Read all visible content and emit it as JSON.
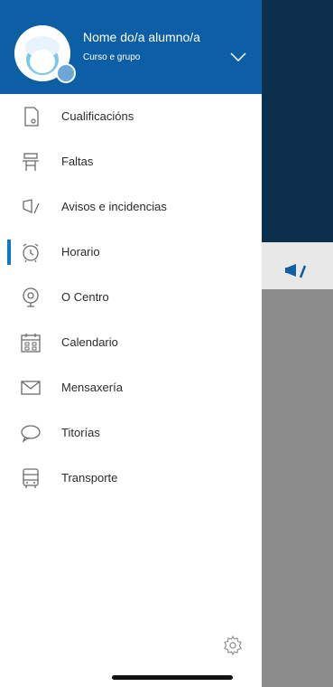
{
  "profile": {
    "name": "Nome do/a alumno/a",
    "group": "Curso e grupo"
  },
  "menu": [
    {
      "label": "Cualificacións",
      "icon": "grades-document-icon",
      "active": false
    },
    {
      "label": "Faltas",
      "icon": "school-desk-icon",
      "active": false
    },
    {
      "label": "Avisos e incidencias",
      "icon": "megaphone-icon",
      "active": false
    },
    {
      "label": "Horario",
      "icon": "alarm-clock-icon",
      "active": true
    },
    {
      "label": "O Centro",
      "icon": "bell-icon",
      "active": false
    },
    {
      "label": "Calendario",
      "icon": "calendar-icon",
      "active": false
    },
    {
      "label": "Mensaxería",
      "icon": "envelope-icon",
      "active": false
    },
    {
      "label": "Titorías",
      "icon": "chat-bubble-icon",
      "active": false
    },
    {
      "label": "Transporte",
      "icon": "bus-icon",
      "active": false
    }
  ],
  "colors": {
    "header": "#0c5fa5",
    "accent": "#0c7ac7",
    "backdrop_top": "#0c2f4d"
  }
}
